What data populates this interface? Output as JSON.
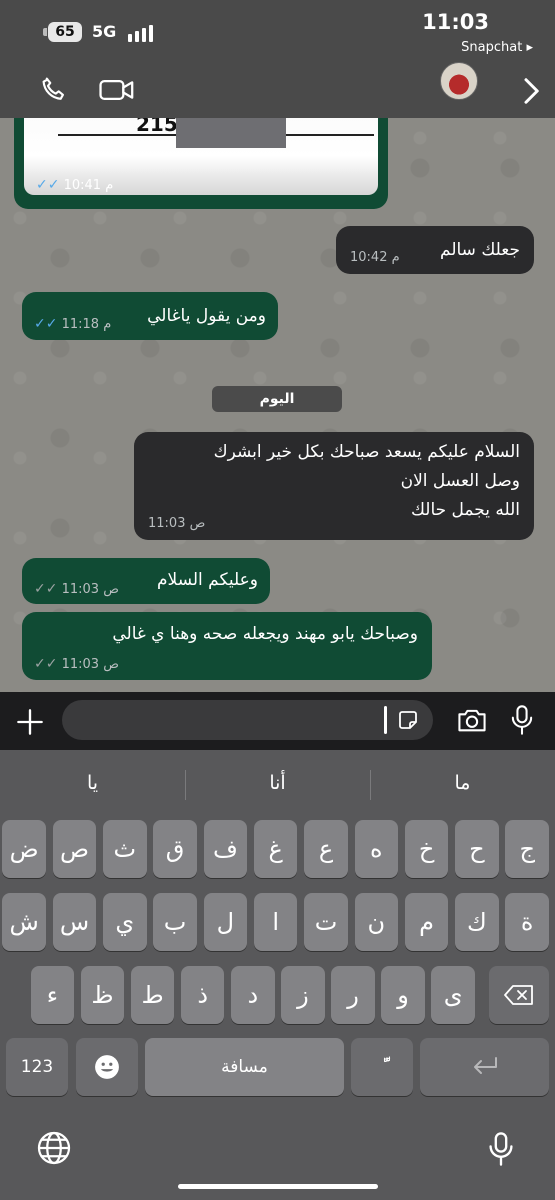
{
  "status": {
    "battery": "65",
    "network": "5G",
    "time": "11:03",
    "back_app": "Snapchat ▸"
  },
  "nav": {
    "call_icon": "phone-icon",
    "video_icon": "video-camera-icon",
    "next_icon": "chevron-right-icon"
  },
  "chat": {
    "image_card": {
      "number": "215",
      "time": "10:41 م"
    },
    "messages": [
      {
        "text": "جعلك سالم",
        "time": "10:42 م",
        "direction": "out"
      },
      {
        "text": "ومن يقول ياغالي",
        "time": "11:18 م",
        "direction": "in",
        "read": true
      },
      {
        "text": "السلام عليكم يسعد صباحك بكل خير ابشرك",
        "text2": "وصل العسل الان",
        "text3": "الله يجمل حالك",
        "time": "11:03 ص",
        "direction": "out"
      },
      {
        "text": "وعليكم السلام",
        "time": "11:03 ص",
        "direction": "in",
        "read": false
      },
      {
        "text": "وصباحك يابو مهند ويجعله صحه وهنا ي غالي",
        "time": "11:03 ص",
        "direction": "in",
        "read": false
      }
    ],
    "day_label": "اليوم"
  },
  "input": {
    "plus_icon": "plus-icon",
    "sticker_icon": "sticker-icon",
    "camera_icon": "camera-icon",
    "mic_icon": "microphone-icon"
  },
  "keyboard": {
    "suggestions": [
      "ما",
      "أنا",
      "يا"
    ],
    "row1": [
      "ج",
      "ح",
      "خ",
      "ه",
      "ع",
      "غ",
      "ف",
      "ق",
      "ث",
      "ص",
      "ض"
    ],
    "row2": [
      "ة",
      "ك",
      "م",
      "ن",
      "ت",
      "ا",
      "ل",
      "ب",
      "ي",
      "س",
      "ش"
    ],
    "row3": [
      "ى",
      "و",
      "ر",
      "ز",
      "د",
      "ذ",
      "ط",
      "ظ",
      "ء"
    ],
    "numbers_key": "123",
    "space_key": "مسافة",
    "diacritic_key": "ًّ",
    "emoji_icon": "emoji-icon",
    "globe_icon": "globe-icon",
    "dictation_icon": "microphone-icon",
    "delete_icon": "delete-icon",
    "return_icon": "return-icon"
  }
}
